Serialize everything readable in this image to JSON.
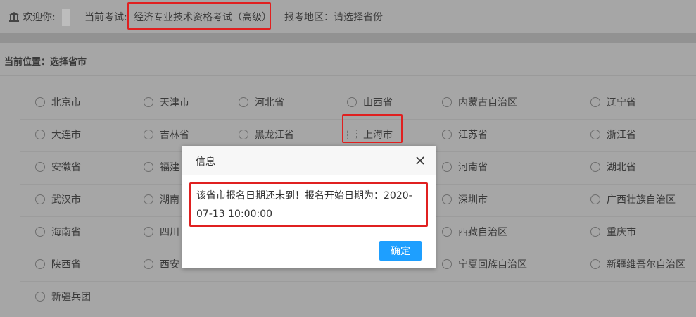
{
  "header": {
    "welcome_label": "欢迎你:",
    "exam_label": "当前考试:",
    "exam_name": "经济专业技术资格考试（高级）",
    "region_label": "报考地区：请选择省份"
  },
  "breadcrumb": "当前位置：选择省市",
  "provinces": [
    [
      "北京市",
      "天津市",
      "河北省",
      "山西省",
      "内蒙古自治区",
      "辽宁省"
    ],
    [
      "大连市",
      "吉林省",
      "黑龙江省",
      "上海市",
      "江苏省",
      "浙江省"
    ],
    [
      "安徽省",
      "福建",
      "",
      "",
      "河南省",
      "湖北省"
    ],
    [
      "武汉市",
      "湖南",
      "",
      "",
      "深圳市",
      "广西壮族自治区"
    ],
    [
      "海南省",
      "四川",
      "",
      "",
      "西藏自治区",
      "重庆市"
    ],
    [
      "陕西省",
      "西安",
      "",
      "",
      "宁夏回族自治区",
      "新疆维吾尔自治区"
    ],
    [
      "新疆兵团",
      "",
      "",
      "",
      "",
      ""
    ]
  ],
  "dialog": {
    "title": "信息",
    "message": "该省市报名日期还未到！报名开始日期为：2020-07-13 10:00:00",
    "confirm_label": "确定"
  }
}
